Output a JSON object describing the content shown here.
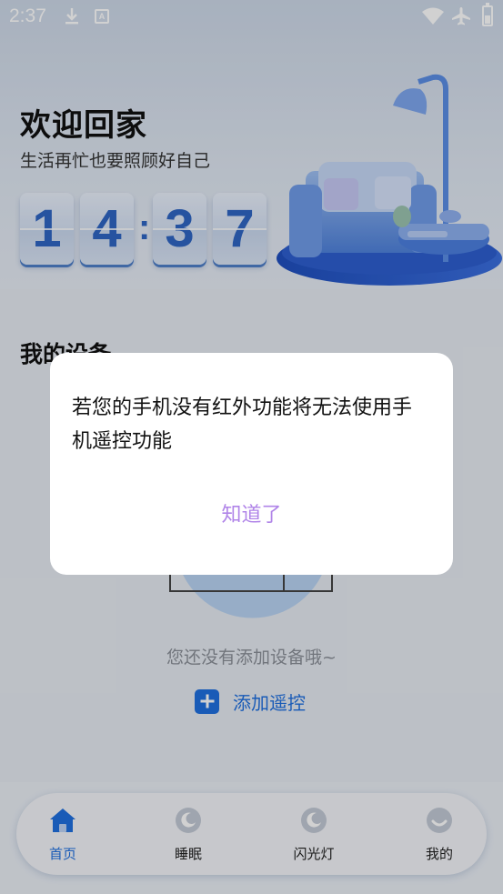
{
  "status_bar": {
    "time": "2:37",
    "a_icon_text": "A",
    "icons": [
      "download-icon",
      "text-a-icon",
      "wifi-icon",
      "airplane-icon",
      "battery-icon"
    ]
  },
  "header": {
    "title": "欢迎回家",
    "subtitle": "生活再忙也要照顾好自己"
  },
  "clock": {
    "d1": "1",
    "d2": "4",
    "colon": ":",
    "d3": "3",
    "d4": "7"
  },
  "devices": {
    "title": "我的设备",
    "empty_text": "您还没有添加设备哦~",
    "add_label": "添加遥控"
  },
  "tabs": [
    {
      "label": "首页",
      "icon": "home-icon",
      "active": true
    },
    {
      "label": "睡眠",
      "icon": "moon-icon",
      "active": false
    },
    {
      "label": "闪光灯",
      "icon": "moon-icon",
      "active": false
    },
    {
      "label": "我的",
      "icon": "profile-icon",
      "active": false
    }
  ],
  "dialog": {
    "message": "若您的手机没有红外功能将无法使用手机遥控功能",
    "ok_label": "知道了"
  },
  "colors": {
    "accent": "#1f6fe0",
    "dialog_button": "#b084e8",
    "clock_digit": "#2f66c4"
  }
}
